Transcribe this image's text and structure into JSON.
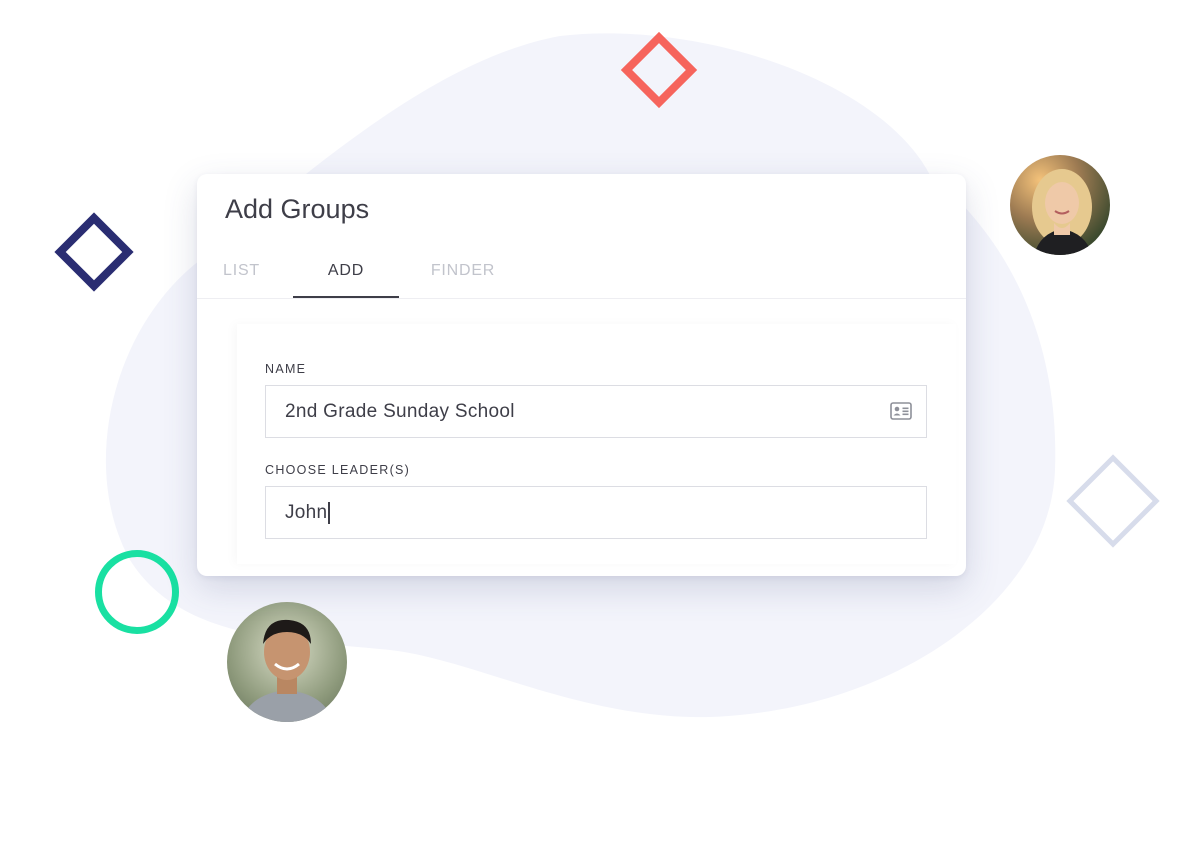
{
  "card": {
    "title": "Add Groups"
  },
  "tabs": [
    {
      "label": "LIST",
      "active": false
    },
    {
      "label": "ADD",
      "active": true
    },
    {
      "label": "FINDER",
      "active": false
    }
  ],
  "form": {
    "name_label": "NAME",
    "name_value": "2nd Grade Sunday School",
    "name_icon": "contact-card-icon",
    "leader_label": "CHOOSE LEADER(S)",
    "leader_value": "John"
  },
  "colors": {
    "accent_red": "#f6645c",
    "accent_navy": "#2a2d72",
    "accent_green": "#19e0a2",
    "accent_light": "#d7dceb",
    "blob": "#f3f4fb",
    "text": "#3e3e48",
    "tab_inactive": "#c2c4cc"
  }
}
